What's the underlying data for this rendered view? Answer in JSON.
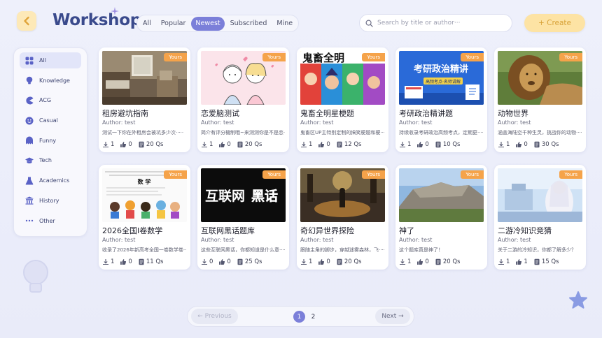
{
  "header": {
    "logo": "Workshop",
    "filters": [
      "All",
      "Popular",
      "Newest",
      "Subscribed",
      "Mine"
    ],
    "active_filter": "Newest",
    "search_placeholder": "Search by title or author···",
    "create_label": "+ Create"
  },
  "sidebar": {
    "items": [
      {
        "label": "All",
        "icon": "grid-icon",
        "active": true
      },
      {
        "label": "Knowledge",
        "icon": "lightbulb-icon"
      },
      {
        "label": "ACG",
        "icon": "pacman-icon"
      },
      {
        "label": "Casual",
        "icon": "smile-icon"
      },
      {
        "label": "Funny",
        "icon": "ghost-icon"
      },
      {
        "label": "Tech",
        "icon": "graduation-cap-icon"
      },
      {
        "label": "Academics",
        "icon": "flask-icon"
      },
      {
        "label": "History",
        "icon": "temple-icon"
      },
      {
        "label": "Other",
        "icon": "more-dots-icon"
      }
    ]
  },
  "badge_label": "Yours",
  "cards": [
    {
      "title": "租房避坑指南",
      "author": "Author: test",
      "desc": "测试一下你在外租房会被坑多少次·····",
      "downloads": "1",
      "likes": "0",
      "questions": "20 Qs",
      "thumb": "room"
    },
    {
      "title": "恋爱脑测试",
      "author": "Author: test",
      "desc": "简介有评分機制哦~来测测你是不是恋····",
      "downloads": "1",
      "likes": "0",
      "questions": "20 Qs",
      "thumb": "couple"
    },
    {
      "title": "鬼畜全明星梗题",
      "author": "Author: test",
      "desc": "鬼畜区UP主特别定制的搞笑梗题和梗····",
      "downloads": "1",
      "likes": "0",
      "questions": "12 Qs",
      "thumb": "comic",
      "thumb_text": "鬼畜全明"
    },
    {
      "title": "考研政治精讲题",
      "author": "Author: test",
      "desc": "持续收录考研政治高频考点，定期更····",
      "downloads": "1",
      "likes": "0",
      "questions": "10 Qs",
      "thumb": "exam",
      "thumb_text": "考研政治精讲",
      "thumb_sub": "高频考点·名师讲解"
    },
    {
      "title": "动物世界",
      "author": "Author: test",
      "desc": "涵盖海陆空千种生灵，挑战你的动物····",
      "downloads": "1",
      "likes": "0",
      "questions": "30 Qs",
      "thumb": "lion"
    },
    {
      "title": "2026全国I卷数学",
      "author": "Author: test",
      "desc": "收录了2026年新高考全国一卷数学卷····",
      "downloads": "1",
      "likes": "0",
      "questions": "11 Qs",
      "thumb": "paper",
      "thumb_text": "数 学"
    },
    {
      "title": "互联网黑话题库",
      "author": "Author: test",
      "desc": "这些互联网黑话，你都知道是什么意····",
      "downloads": "0",
      "likes": "0",
      "questions": "25 Qs",
      "thumb": "slang",
      "thumb_text": "互联网",
      "thumb_text2": "黑话"
    },
    {
      "title": "奇幻异世界探险",
      "author": "Author: test",
      "desc": "跟随主角的脚步，穿越迷雾森林，飞····",
      "downloads": "1",
      "likes": "0",
      "questions": "20 Qs",
      "thumb": "fantasy"
    },
    {
      "title": "神了",
      "author": "Author: test",
      "desc": "这个题库真是神了！",
      "downloads": "1",
      "likes": "0",
      "questions": "20 Qs",
      "thumb": "mountain"
    },
    {
      "title": "二游冷知识竞猜",
      "author": "Author: test",
      "desc": "关于二游的冷知识，你都了解多少？",
      "downloads": "1",
      "likes": "1",
      "questions": "15 Qs",
      "thumb": "anime"
    }
  ],
  "pagination": {
    "prev_label": "← Previous",
    "next_label": "Next →",
    "pages": [
      "1",
      "2"
    ],
    "current": "1"
  }
}
